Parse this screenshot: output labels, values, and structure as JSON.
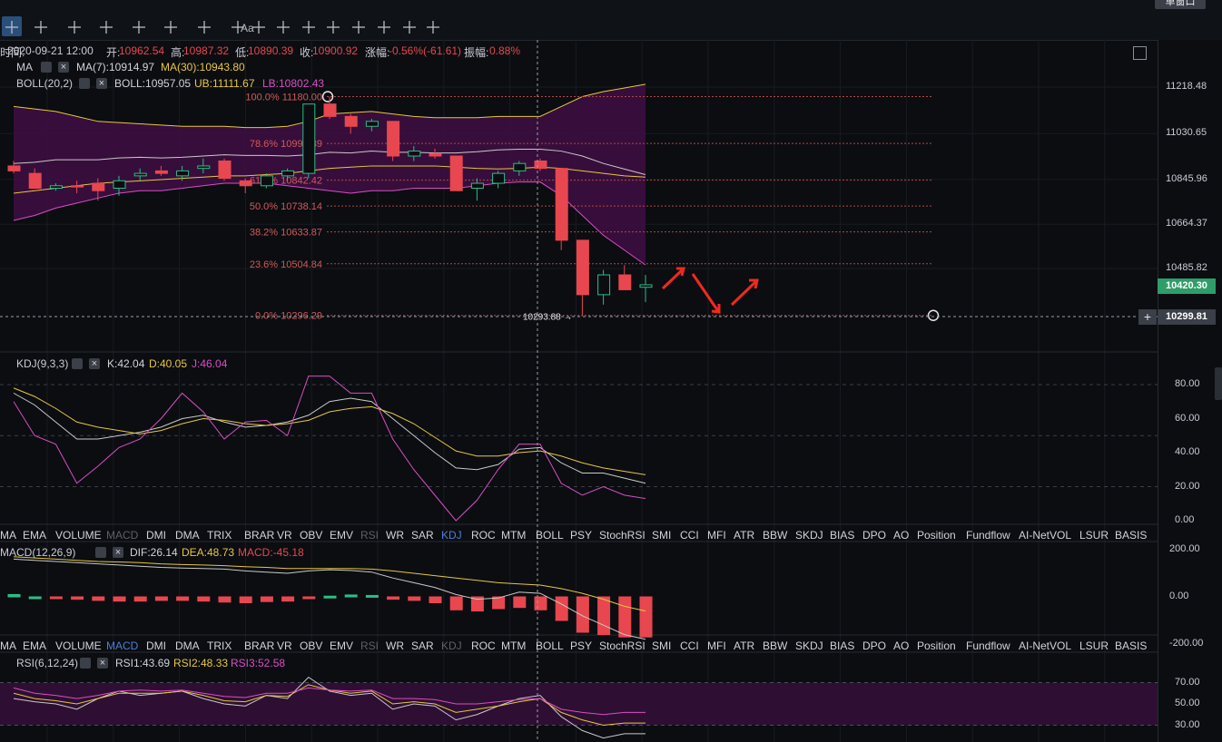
{
  "toolbar": {
    "icons": [
      "crosshair-icon",
      "horizontal-line-icon",
      "trend-line-icon",
      "rectangle-icon",
      "channel-icon",
      "wave-icon",
      "measure-icon",
      "text-icon",
      "pattern-icon",
      "ruler-icon",
      "brush-icon",
      "eye-icon",
      "lock-icon",
      "copy-icon",
      "layers-icon",
      "delete-icon"
    ],
    "text_label": "Aa",
    "layout_button": "单窗口"
  },
  "info": {
    "time_label": "时间:",
    "time": "2020-09-21 12:00",
    "open_label": "开:",
    "open": "10962.54",
    "high_label": "高:",
    "high": "10987.32",
    "low_label": "低:",
    "low": "10890.39",
    "close_label": "收:",
    "close": "10900.92",
    "change_label": "涨幅:",
    "change": "-0.56%(-61.61)",
    "amp_label": "振幅:",
    "amp": "0.88%"
  },
  "ma": {
    "name": "MA",
    "ma7": "MA(7):10914.97",
    "ma30": "MA(30):10943.80"
  },
  "boll": {
    "name": "BOLL(20,2)",
    "mid": "BOLL:10957.05",
    "ub": "UB:11111.67",
    "lb": "LB:10802.43"
  },
  "kdj": {
    "name": "KDJ(9,3,3)",
    "k": "K:42.04",
    "d": "D:40.05",
    "j": "J:46.04"
  },
  "macd": {
    "name": "MACD(12,26,9)",
    "dif": "DIF:26.14",
    "dea": "DEA:48.73",
    "macd": "MACD:-45.18"
  },
  "rsi": {
    "name": "RSI(6,12,24)",
    "rsi1": "RSI1:43.69",
    "rsi2": "RSI2:48.33",
    "rsi3": "RSI3:52.58"
  },
  "tabs": [
    "MA",
    "EMA",
    "VOLUME",
    "MACD",
    "DMI",
    "DMA",
    "TRIX",
    "BRAR",
    "VR",
    "OBV",
    "EMV",
    "RSI",
    "WR",
    "SAR",
    "KDJ",
    "ROC",
    "MTM",
    "BOLL",
    "PSY",
    "StochRSI",
    "SMI",
    "CCI",
    "MFI",
    "ATR",
    "BBW",
    "SKDJ",
    "BIAS",
    "DPO",
    "AO",
    "Position",
    "Fundflow",
    "AI-NetVOL",
    "LSUR",
    "BASIS"
  ],
  "tabs_row1_active": "KDJ",
  "tabs_row1_dim": [
    "MACD",
    "RSI"
  ],
  "tabs_row2_active": "MACD",
  "tabs_row2_dim": [
    "RSI",
    "KDJ"
  ],
  "price_axis": [
    "11218.48",
    "11030.65",
    "10845.96",
    "10664.37",
    "10485.82"
  ],
  "current_price": "10420.30",
  "cursor_price": "10299.81",
  "low_marker": "10293.88",
  "kdj_axis": [
    "80.00",
    "60.00",
    "40.00",
    "20.00",
    "0.00"
  ],
  "macd_axis": [
    "200.00",
    "0.00",
    "-200.00"
  ],
  "rsi_axis": [
    "70.00",
    "50.00",
    "30.00"
  ],
  "fib_levels": [
    {
      "label": "100.0% 11180.00",
      "price": 11180.0
    },
    {
      "label": "78.6% 10990.89",
      "price": 10990.89
    },
    {
      "label": "61.8% 10842.42",
      "price": 10842.42
    },
    {
      "label": "50.0% 10738.14",
      "price": 10738.14
    },
    {
      "label": "38.2% 10633.87",
      "price": 10633.87
    },
    {
      "label": "23.6% 10504.84",
      "price": 10504.84
    },
    {
      "label": "0.0% 10296.29",
      "price": 10296.29
    }
  ],
  "colors": {
    "up": "#2ebd85",
    "down": "#e8474f",
    "boll_fill": "#3a0f3e",
    "ma7": "#c9c9c9",
    "ma30": "#e6c740",
    "lb": "#d84ec4",
    "fib": "#b64545",
    "kdj_k": "#c9c9c9",
    "kdj_d": "#e6c740",
    "kdj_j": "#d84ec4"
  },
  "chart_data": [
    {
      "type": "candlestick",
      "title": "",
      "y_axis_ticks": [
        11218.48,
        11030.65,
        10845.96,
        10664.37,
        10485.82
      ],
      "candles": [
        {
          "o": 10900,
          "h": 10920,
          "l": 10870,
          "c": 10880
        },
        {
          "o": 10870,
          "h": 10890,
          "l": 10830,
          "c": 10810
        },
        {
          "o": 10810,
          "h": 10830,
          "l": 10800,
          "c": 10820
        },
        {
          "o": 10820,
          "h": 10840,
          "l": 10790,
          "c": 10815
        },
        {
          "o": 10830,
          "h": 10850,
          "l": 10760,
          "c": 10800
        },
        {
          "o": 10810,
          "h": 10860,
          "l": 10780,
          "c": 10840
        },
        {
          "o": 10860,
          "h": 10890,
          "l": 10840,
          "c": 10870
        },
        {
          "o": 10880,
          "h": 10900,
          "l": 10860,
          "c": 10870
        },
        {
          "o": 10860,
          "h": 10900,
          "l": 10840,
          "c": 10880
        },
        {
          "o": 10890,
          "h": 10930,
          "l": 10870,
          "c": 10900
        },
        {
          "o": 10920,
          "h": 10930,
          "l": 10840,
          "c": 10850
        },
        {
          "o": 10840,
          "h": 10850,
          "l": 10790,
          "c": 10820
        },
        {
          "o": 10820,
          "h": 10870,
          "l": 10810,
          "c": 10860
        },
        {
          "o": 10860,
          "h": 10890,
          "l": 10840,
          "c": 10880
        },
        {
          "o": 10870,
          "h": 11100,
          "l": 10850,
          "c": 11150
        },
        {
          "o": 11150,
          "h": 11180,
          "l": 11090,
          "c": 11100
        },
        {
          "o": 11100,
          "h": 11110,
          "l": 11030,
          "c": 11060
        },
        {
          "o": 11060,
          "h": 11090,
          "l": 11040,
          "c": 11080
        },
        {
          "o": 11080,
          "h": 11080,
          "l": 10920,
          "c": 10940
        },
        {
          "o": 10940,
          "h": 10980,
          "l": 10920,
          "c": 10960
        },
        {
          "o": 10950,
          "h": 10970,
          "l": 10930,
          "c": 10940
        },
        {
          "o": 10940,
          "h": 10940,
          "l": 10800,
          "c": 10800
        },
        {
          "o": 10810,
          "h": 10850,
          "l": 10760,
          "c": 10830
        },
        {
          "o": 10830,
          "h": 10880,
          "l": 10810,
          "c": 10870
        },
        {
          "o": 10880,
          "h": 10920,
          "l": 10860,
          "c": 10910
        },
        {
          "o": 10920,
          "h": 10930,
          "l": 10880,
          "c": 10890
        },
        {
          "o": 10890,
          "h": 10890,
          "l": 10560,
          "c": 10600
        },
        {
          "o": 10600,
          "h": 10600,
          "l": 10294,
          "c": 10380
        },
        {
          "o": 10380,
          "h": 10480,
          "l": 10340,
          "c": 10460
        },
        {
          "o": 10460,
          "h": 10500,
          "l": 10400,
          "c": 10400
        },
        {
          "o": 10410,
          "h": 10460,
          "l": 10350,
          "c": 10420
        }
      ],
      "current_price": 10420.3,
      "low_marker": 10293.88
    },
    {
      "type": "line",
      "title": "KDJ(9,3,3)",
      "ylim": [
        0,
        90
      ],
      "series": [
        {
          "name": "K",
          "values": [
            75,
            68,
            58,
            48,
            48,
            50,
            52,
            55,
            60,
            62,
            58,
            55,
            56,
            58,
            62,
            70,
            72,
            70,
            60,
            50,
            40,
            31,
            30,
            33,
            42,
            43,
            34,
            28,
            28,
            25,
            22
          ]
        },
        {
          "name": "D",
          "values": [
            78,
            73,
            66,
            58,
            55,
            53,
            51,
            53,
            57,
            60,
            59,
            57,
            56,
            57,
            59,
            64,
            66,
            67,
            63,
            57,
            49,
            41,
            38,
            38,
            40,
            41,
            38,
            34,
            31,
            29,
            27
          ]
        },
        {
          "name": "J",
          "values": [
            70,
            50,
            45,
            22,
            32,
            43,
            48,
            60,
            75,
            64,
            48,
            58,
            59,
            50,
            85,
            85,
            75,
            75,
            48,
            30,
            15,
            0,
            12,
            30,
            45,
            45,
            22,
            15,
            20,
            15,
            13
          ]
        }
      ]
    },
    {
      "type": "bar",
      "title": "MACD(12,26,9)",
      "ylim": [
        -230,
        230
      ],
      "histogram": [
        10,
        0,
        -5,
        -10,
        -15,
        -18,
        -18,
        -15,
        -15,
        -18,
        -22,
        -25,
        -20,
        -18,
        -5,
        3,
        8,
        6,
        -10,
        -15,
        -25,
        -55,
        -60,
        -50,
        -45,
        -55,
        -100,
        -150,
        -160,
        -170,
        -170
      ],
      "series": [
        {
          "name": "DIF",
          "values": [
            160,
            155,
            150,
            145,
            140,
            135,
            130,
            125,
            122,
            120,
            118,
            110,
            105,
            100,
            110,
            115,
            112,
            105,
            80,
            60,
            40,
            10,
            -10,
            -5,
            20,
            15,
            -30,
            -80,
            -120,
            -160,
            -180
          ]
        },
        {
          "name": "DEA",
          "values": [
            170,
            165,
            160,
            155,
            150,
            148,
            145,
            140,
            137,
            135,
            132,
            128,
            125,
            120,
            120,
            120,
            120,
            118,
            110,
            100,
            90,
            80,
            70,
            60,
            55,
            50,
            35,
            15,
            -10,
            -40,
            -60
          ]
        }
      ]
    },
    {
      "type": "line",
      "title": "RSI(6,12,24)",
      "ylim": [
        15,
        85
      ],
      "series": [
        {
          "name": "RSI1",
          "values": [
            55,
            52,
            50,
            45,
            55,
            62,
            58,
            60,
            62,
            55,
            50,
            48,
            58,
            55,
            75,
            62,
            58,
            60,
            45,
            50,
            48,
            35,
            40,
            48,
            55,
            58,
            38,
            25,
            18,
            22,
            22
          ]
        },
        {
          "name": "RSI2",
          "values": [
            60,
            55,
            53,
            50,
            55,
            60,
            60,
            60,
            62,
            58,
            53,
            52,
            58,
            57,
            68,
            63,
            60,
            62,
            50,
            52,
            50,
            42,
            45,
            48,
            52,
            55,
            42,
            35,
            30,
            32,
            32
          ]
        },
        {
          "name": "RSI3",
          "values": [
            65,
            60,
            58,
            55,
            58,
            62,
            63,
            62,
            63,
            60,
            57,
            56,
            60,
            60,
            65,
            63,
            62,
            63,
            55,
            55,
            54,
            50,
            50,
            52,
            54,
            55,
            45,
            42,
            40,
            42,
            42
          ]
        }
      ]
    }
  ]
}
